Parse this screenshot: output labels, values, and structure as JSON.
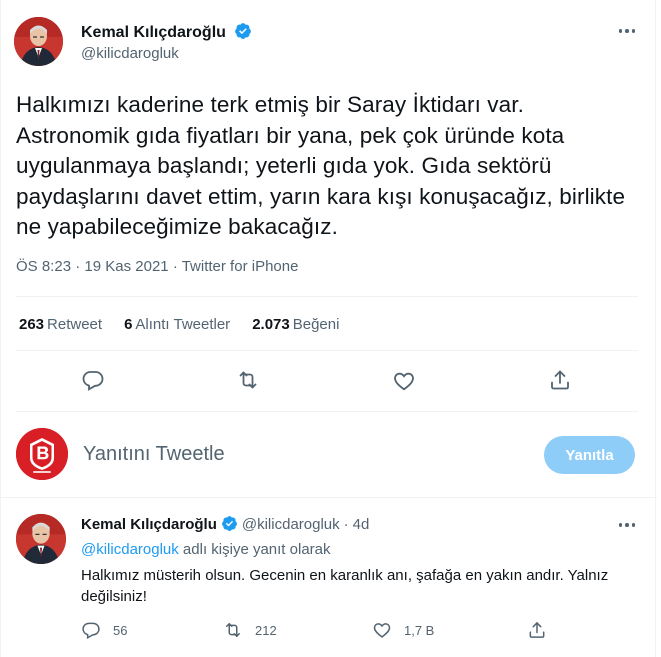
{
  "main_tweet": {
    "author_name": "Kemal Kılıçdaroğlu",
    "author_handle": "@kilicdarogluk",
    "text": "Halkımızı kaderine terk etmiş bir Saray İktidarı var. Astronomik gıda fiyatları bir yana, pek çok üründe kota uygulanmaya başlandı; yeterli gıda yok. Gıda sektörü paydaşlarını davet ettim, yarın kara kışı konuşacağız, birlikte ne yapabileceğimize bakacağız.",
    "time": "ÖS 8:23",
    "date": "19 Kas 2021",
    "source": "Twitter for iPhone",
    "separator": "·",
    "stats": {
      "retweets_count": "263",
      "retweets_label": "Retweet",
      "quotes_count": "6",
      "quotes_label": "Alıntı Tweetler",
      "likes_count": "2.073",
      "likes_label": "Beğeni"
    },
    "actions": [
      "reply-icon",
      "retweet-icon",
      "like-icon",
      "share-icon"
    ]
  },
  "composer": {
    "placeholder": "Yanıtını Tweetle",
    "button_label": "Yanıtla",
    "avatar_icon": "brand-logo-icon"
  },
  "reply_tweet": {
    "author_name": "Kemal Kılıçdaroğlu",
    "author_handle": "@kilicdarogluk",
    "separator": "·",
    "time_ago": "4d",
    "reply_to_mention": "@kilicdarogluk",
    "reply_to_suffix": " adlı kişiye yanıt olarak",
    "text": "Halkımız müsterih olsun. Gecenin en karanlık anı, şafağa en yakın andır. Yalnız değilsiniz!",
    "reply_count": "56",
    "retweet_count": "212",
    "like_count": "1,7 B"
  },
  "colors": {
    "accent": "#1d9bf0",
    "reply_button_disabled": "#8ecdf8",
    "secondary_text": "#536471",
    "brand_red": "#d81f26"
  }
}
